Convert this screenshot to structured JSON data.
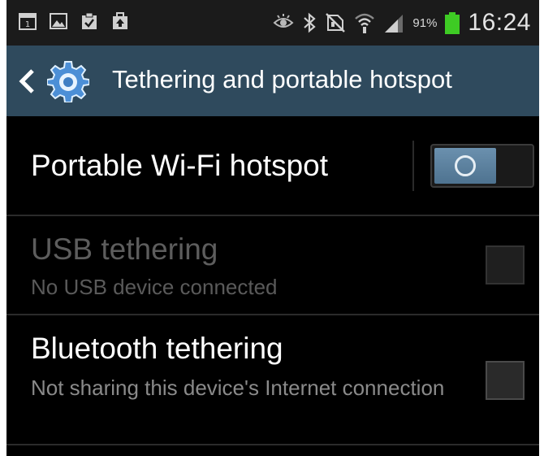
{
  "status_bar": {
    "notification_icons": [
      "calendar-icon",
      "gallery-icon",
      "clipboard-check-icon",
      "upload-bag-icon"
    ],
    "system_icons": [
      "eye-icon",
      "bluetooth-icon",
      "no-sim-icon",
      "wifi-icon",
      "signal-icon"
    ],
    "battery_percent": "91%",
    "time": "16:24"
  },
  "action_bar": {
    "back_icon": "chevron-left-icon",
    "app_icon": "gear-icon",
    "title": "Tethering and portable hotspot"
  },
  "settings": {
    "wifi_hotspot": {
      "title": "Portable Wi-Fi hotspot",
      "toggle_state": "off"
    },
    "usb_tethering": {
      "title": "USB tethering",
      "subtitle": "No USB device connected",
      "checked": false,
      "enabled": false
    },
    "bluetooth_tethering": {
      "title": "Bluetooth tethering",
      "subtitle": "Not sharing this device's Internet connection",
      "checked": false,
      "enabled": true
    }
  },
  "colors": {
    "background": "#000000",
    "action_bar": "#2f4a5d",
    "accent": "#5b84a6",
    "battery_green": "#3ecb24",
    "subtitle_text": "#8a8a8a"
  }
}
